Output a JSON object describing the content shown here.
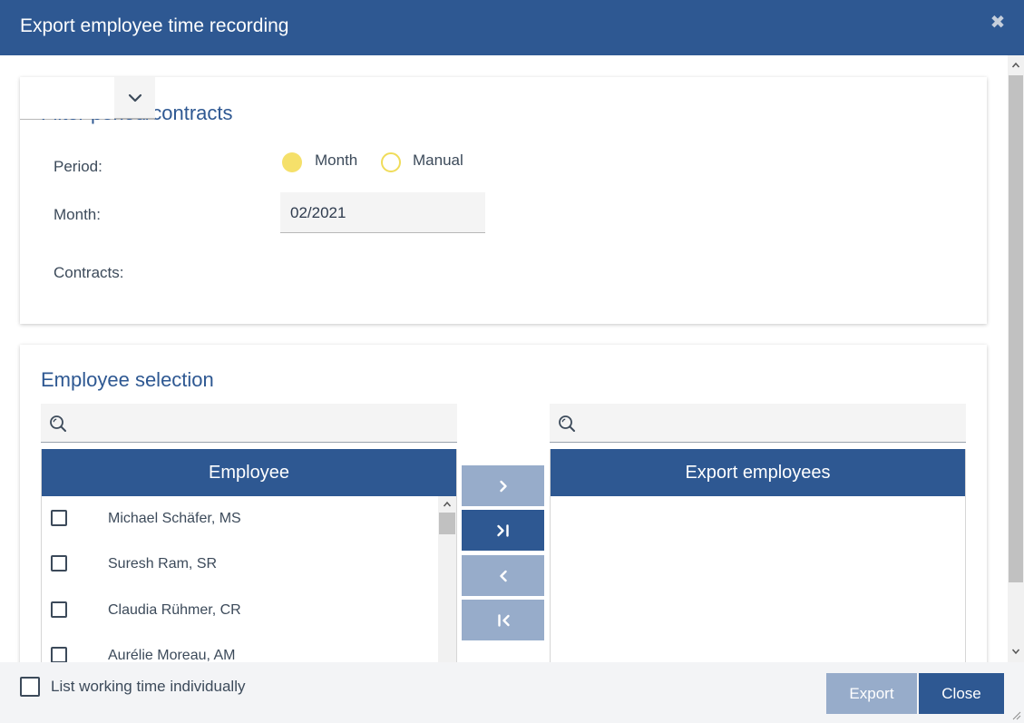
{
  "dialog": {
    "title": "Export employee time recording",
    "close_icon": "close-icon"
  },
  "filter": {
    "section_title": "Filter period/contracts",
    "period_label": "Period:",
    "period_options": [
      {
        "label": "Month",
        "selected": true
      },
      {
        "label": "Manual",
        "selected": false
      }
    ],
    "month_label": "Month:",
    "month_value": "02/2021",
    "contracts_label": "Contracts:",
    "contracts_value": ""
  },
  "employee_selection": {
    "section_title": "Employee selection",
    "left_search_placeholder": "",
    "right_search_placeholder": "",
    "left_header": "Employee",
    "right_header": "Export employees",
    "employees": [
      {
        "name": "Michael Schäfer, MS",
        "checked": false
      },
      {
        "name": "Suresh Ram, SR",
        "checked": false
      },
      {
        "name": "Claudia Rühmer, CR",
        "checked": false
      },
      {
        "name": "Aurélie Moreau, AM",
        "checked": false
      }
    ],
    "export_employees": [],
    "move_buttons": [
      {
        "icon": "chevron-right-icon",
        "enabled": false
      },
      {
        "icon": "move-all-right-icon",
        "enabled": true
      },
      {
        "icon": "chevron-left-icon",
        "enabled": false
      },
      {
        "icon": "move-all-left-icon",
        "enabled": false
      }
    ]
  },
  "footer": {
    "list_individually_label": "List working time individually",
    "list_individually_checked": false,
    "export_button": "Export",
    "close_button": "Close"
  },
  "colors": {
    "primary": "#2e5892",
    "primary_disabled": "#97acca",
    "radio_accent": "#f5e06a"
  }
}
